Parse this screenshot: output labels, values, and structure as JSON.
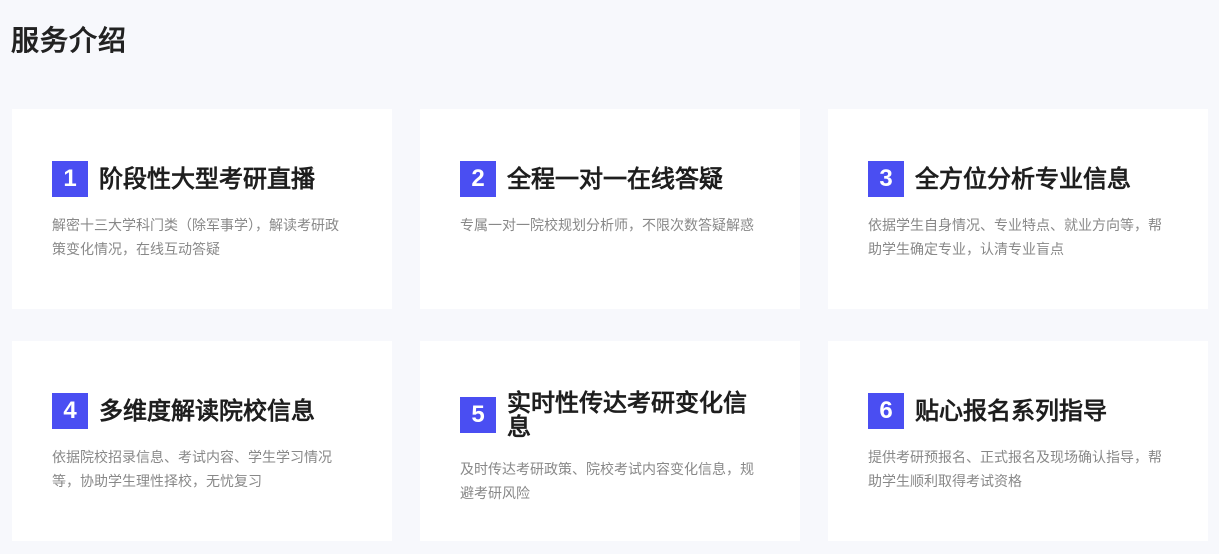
{
  "section": {
    "title": "服务介绍"
  },
  "colors": {
    "accent": "#4a4ef2",
    "background": "#f7f8fc",
    "card": "#ffffff"
  },
  "cards": [
    {
      "number": "1",
      "title": "阶段性大型考研直播",
      "desc": "解密十三大学科门类（除军事学），解读考研政策变化情况，在线互动答疑"
    },
    {
      "number": "2",
      "title": "全程一对一在线答疑",
      "desc": "专属一对一院校规划分析师，不限次数答疑解惑"
    },
    {
      "number": "3",
      "title": "全方位分析专业信息",
      "desc": "依据学生自身情况、专业特点、就业方向等，帮助学生确定专业，认清专业盲点"
    },
    {
      "number": "4",
      "title": "多维度解读院校信息",
      "desc": "依据院校招录信息、考试内容、学生学习情况等，协助学生理性择校，无忧复习"
    },
    {
      "number": "5",
      "title": "实时性传达考研变化信息",
      "desc": "及时传达考研政策、院校考试内容变化信息，规避考研风险"
    },
    {
      "number": "6",
      "title": "贴心报名系列指导",
      "desc": "提供考研预报名、正式报名及现场确认指导，帮助学生顺利取得考试资格"
    }
  ]
}
